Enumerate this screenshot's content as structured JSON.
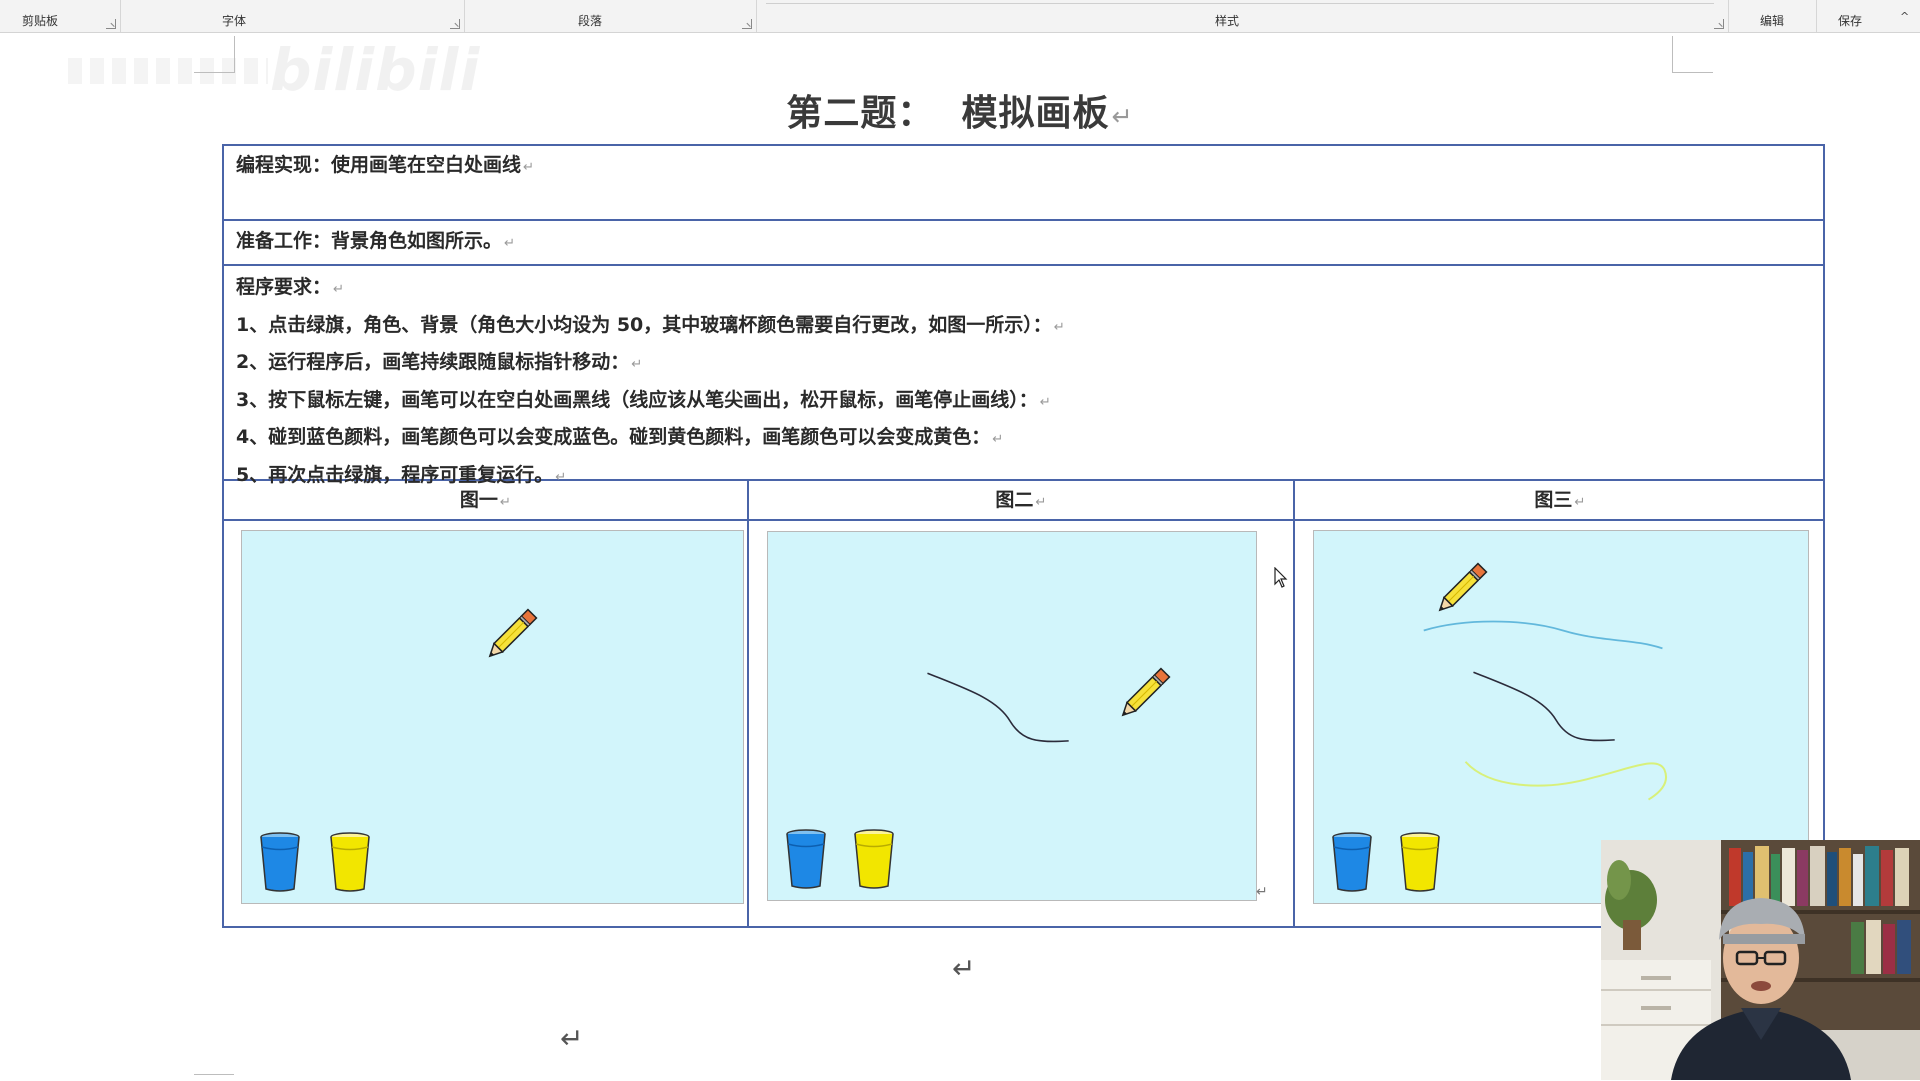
{
  "ribbon": {
    "groups": [
      {
        "label": "剪贴板"
      },
      {
        "label": "字体"
      },
      {
        "label": "段落"
      },
      {
        "label": "样式"
      },
      {
        "label": "编辑"
      },
      {
        "label": "保存"
      }
    ]
  },
  "watermark": "bilibili",
  "document": {
    "title": "第二题：  模拟画板",
    "paragraph_mark": "↵",
    "rows": {
      "implementation": "编程实现：使用画笔在空白处画线",
      "preparation": "准备工作：背景角色如图所示。",
      "requirements_heading": "程序要求：",
      "requirements": [
        "1、点击绿旗，角色、背景（角色大小均设为 50，其中玻璃杯颜色需要自行更改，如图一所示）：",
        "2、运行程序后，画笔持续跟随鼠标指针移动：",
        "3、按下鼠标左键，画笔可以在空白处画黑线（线应该从笔尖画出，松开鼠标，画笔停止画线）：",
        "4、碰到蓝色颜料，画笔颜色可以会变成蓝色。碰到黄色颜料，画笔颜色可以会变成黄色：",
        "5、再次点击绿旗，程序可重复运行。"
      ]
    },
    "figures": [
      {
        "label": "图一"
      },
      {
        "label": "图二"
      },
      {
        "label": "图三"
      }
    ]
  },
  "colors": {
    "table_border": "#4a64a8",
    "stage_bg": "#d2f5fb",
    "cup_blue": "#1e88e5",
    "cup_yellow": "#f2e600",
    "line_black": "#2b2b3a",
    "line_blue": "#62b8dc",
    "line_yellow": "#d8f07a"
  },
  "icons": {
    "cup_blue": "blue-cup-icon",
    "cup_yellow": "yellow-cup-icon",
    "pencil": "pencil-icon",
    "cursor": "mouse-cursor-icon"
  }
}
